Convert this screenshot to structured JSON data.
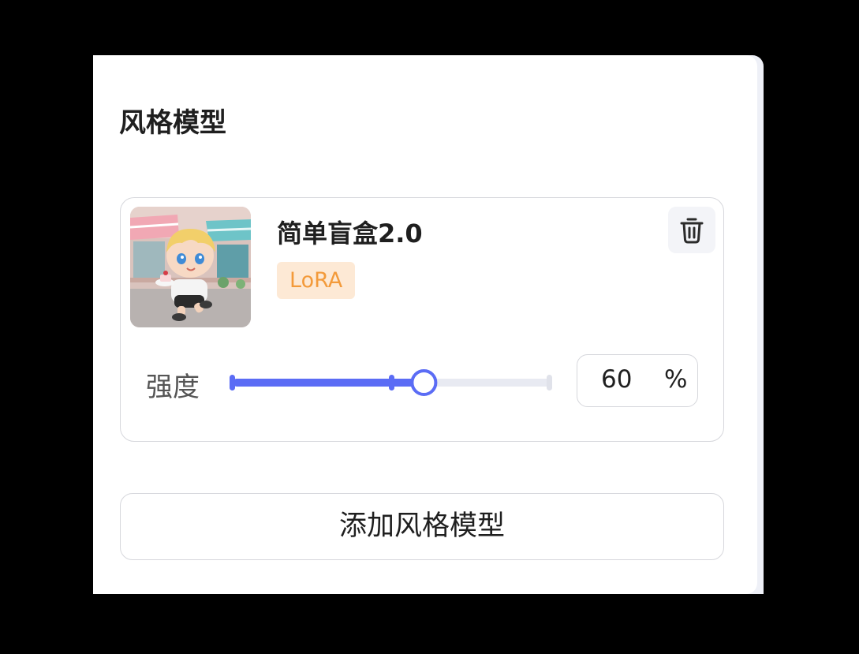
{
  "section": {
    "title": "风格模型"
  },
  "model": {
    "name": "简单盲盒2.0",
    "tag": "LoRA",
    "thumbnail": "chibi-character-running-with-cake-thumbnail",
    "delete_icon": "trash-icon"
  },
  "strength": {
    "label": "强度",
    "value": "60",
    "unit": "%",
    "slider_fraction": 0.6
  },
  "add_button": {
    "label": "添加风格模型"
  },
  "colors": {
    "accent": "#5b6cf5",
    "tag_text": "#f39a3a",
    "tag_bg": "#fde9d5"
  }
}
